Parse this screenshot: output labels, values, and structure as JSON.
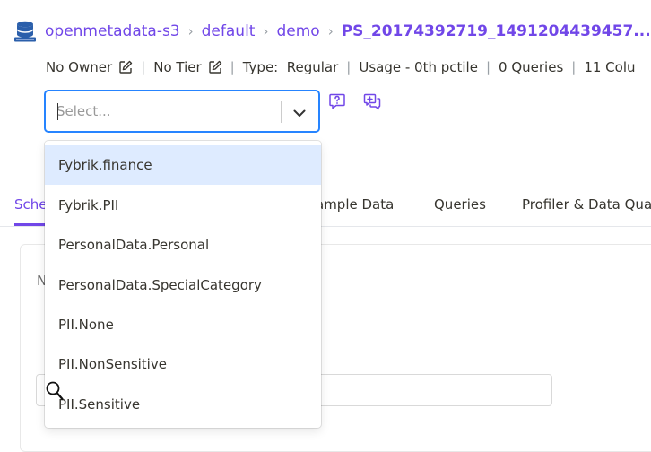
{
  "breadcrumb": {
    "icon": "database-icon",
    "items": [
      "openmetadata-s3",
      "default",
      "demo"
    ],
    "current": "PS_20174392719_1491204439457..."
  },
  "meta": {
    "owner": "No Owner",
    "tier": "No Tier",
    "type": "Type:  Regular",
    "usage": "Usage - 0th pctile",
    "queries": "0 Queries",
    "columns": "11 Colu"
  },
  "tag_select": {
    "placeholder": "Select...",
    "options": [
      "Fybrik.finance",
      "Fybrik.PII",
      "PersonalData.Personal",
      "PersonalData.SpecialCategory",
      "PII.None",
      "PII.NonSensitive",
      "PII.Sensitive"
    ],
    "focused_option": "Fybrik.finance"
  },
  "tabs": {
    "schema": "Sche",
    "sample_data": "ample Data",
    "queries": "Queries",
    "profiler": "Profiler & Data Qua"
  },
  "panel": {
    "heading_fragment": "N"
  },
  "colors": {
    "accent": "#7147e8",
    "focus_border": "#2684ff",
    "option_highlight": "#deebff"
  }
}
